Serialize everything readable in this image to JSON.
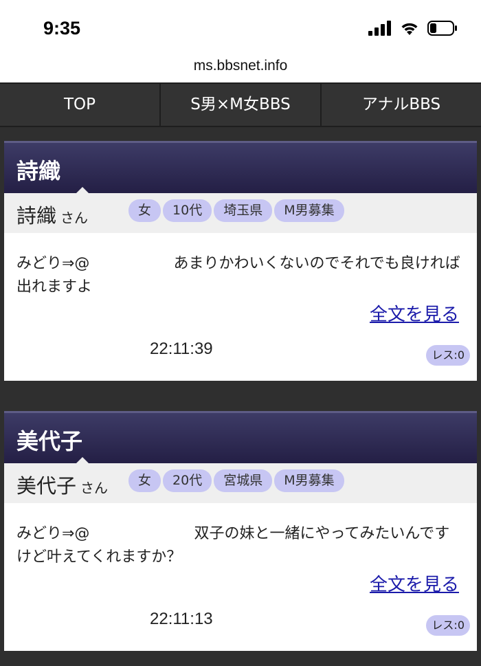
{
  "status": {
    "time": "9:35"
  },
  "browser": {
    "url": "ms.bbsnet.info"
  },
  "nav": {
    "items": [
      {
        "label": "TOP"
      },
      {
        "label": "S男×M女BBS"
      },
      {
        "label": "アナルBBS"
      }
    ]
  },
  "posts": [
    {
      "title": "詩織",
      "user": "詩織",
      "honorific": "さん",
      "tags": [
        "女",
        "10代",
        "埼玉県",
        "M男募集"
      ],
      "message_prefix": "みどり⇒@",
      "message": "あまりかわいくないのでそれでも良ければ出れますよ",
      "more_label": "全文を見る",
      "time": "22:11:39",
      "res_label": "レス:0"
    },
    {
      "title": "美代子",
      "user": "美代子",
      "honorific": "さん",
      "tags": [
        "女",
        "20代",
        "宮城県",
        "M男募集"
      ],
      "message_prefix": "みどり⇒@",
      "message": "双子の妹と一緒にやってみたいんですけど叶えてくれますか？",
      "more_label": "全文を見る",
      "time": "22:11:13",
      "res_label": "レス:0"
    }
  ],
  "colors": {
    "header_gradient_top": "#3d3b66",
    "header_gradient_bottom": "#241f45",
    "tag_bg": "#c7c6f3",
    "link": "#1a1aaa",
    "background": "#2f2f2f"
  }
}
